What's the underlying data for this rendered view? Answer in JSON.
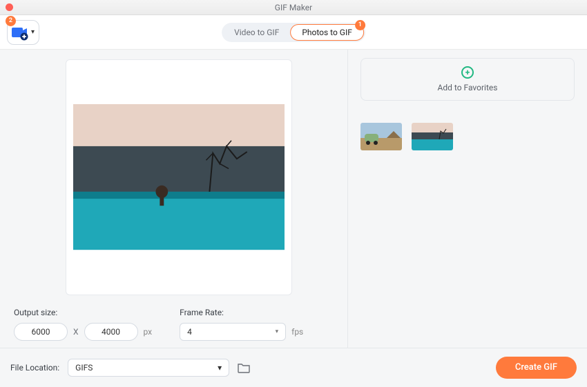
{
  "window": {
    "title": "GIF Maker"
  },
  "toolbar": {
    "media_count": 2,
    "add_media_icon": "add-media-icon"
  },
  "tabs": {
    "items": [
      {
        "label": "Video to GIF",
        "active": false
      },
      {
        "label": "Photos to GIF",
        "active": true,
        "badge": 1
      }
    ]
  },
  "preview": {
    "image_alt": "landscape with water, tree and figure"
  },
  "output_size": {
    "label": "Output size:",
    "width": "6000",
    "height": "4000",
    "separator": "X",
    "unit": "px"
  },
  "frame_rate": {
    "label": "Frame Rate:",
    "value": "4",
    "unit": "fps"
  },
  "favorites": {
    "label": "Add to Favorites"
  },
  "thumbnails": {
    "items": [
      {
        "alt": "green car in desert"
      },
      {
        "alt": "landscape with water"
      }
    ]
  },
  "file_location": {
    "label": "File Location:",
    "value": "GIFS"
  },
  "actions": {
    "create_label": "Create GIF"
  },
  "colors": {
    "accent": "#ff7a3c",
    "green": "#21b882"
  }
}
